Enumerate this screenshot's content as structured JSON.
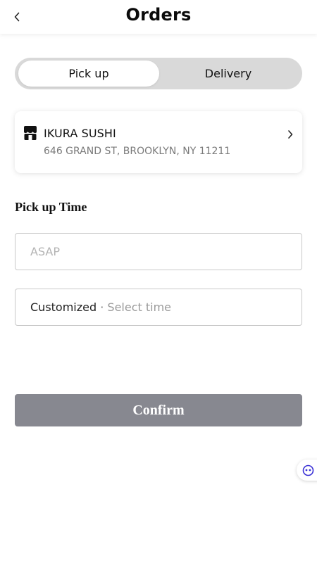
{
  "header": {
    "title": "Orders",
    "back_icon": "chevron-left-icon"
  },
  "order_type": {
    "options": [
      {
        "label": "Pick up",
        "selected": true
      },
      {
        "label": "Delivery",
        "selected": false
      }
    ]
  },
  "store": {
    "icon": "storefront-icon",
    "name": "IKURA SUSHI",
    "address": "646 GRAND ST, BROOKLYN, NY 11211",
    "chevron_icon": "chevron-right-icon"
  },
  "pickup_time": {
    "heading": "Pick up Time",
    "asap_placeholder": "ASAP",
    "customized_label": "Customized",
    "separator": "·",
    "customized_placeholder": "Select time"
  },
  "confirm": {
    "label": "Confirm"
  },
  "assistant": {
    "icon": "chat-bot-icon"
  },
  "colors": {
    "segment_bg": "#d9d9d9",
    "confirm_bg": "#878890",
    "assistant_accent": "#3b32d6"
  }
}
